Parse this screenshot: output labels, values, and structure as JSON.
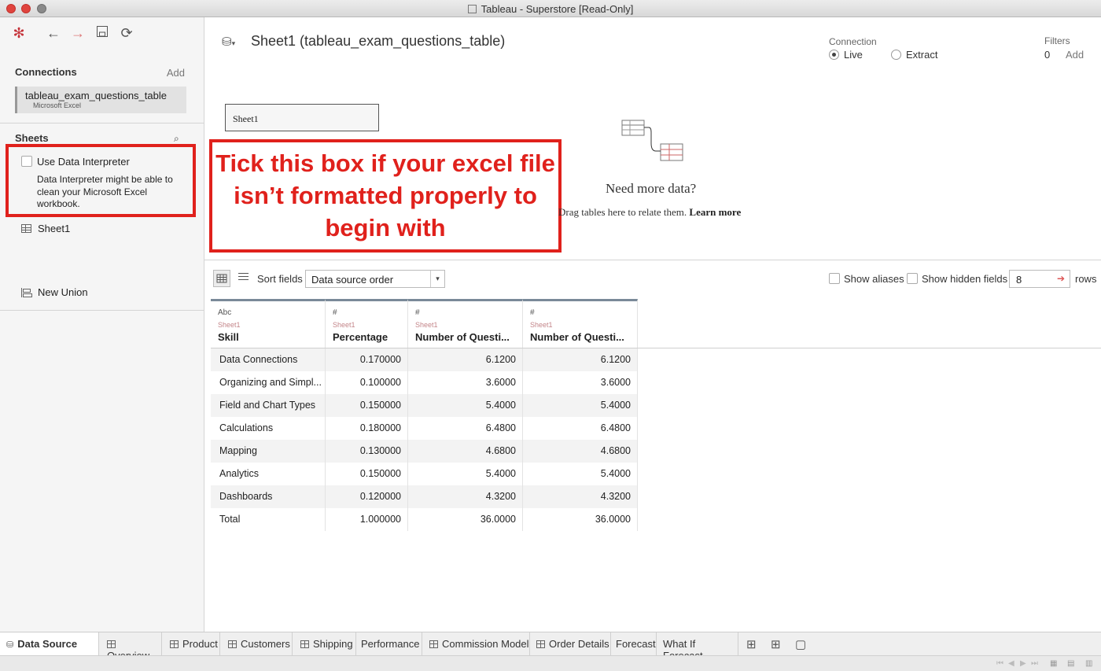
{
  "window": {
    "title": "Tableau - Superstore [Read-Only]"
  },
  "toolbar": {
    "icons": [
      "tableau-logo-icon",
      "back-icon",
      "forward-icon",
      "save-icon",
      "refresh-icon"
    ]
  },
  "sidebar": {
    "connections_title": "Connections",
    "add_label": "Add",
    "connection": {
      "name": "tableau_exam_questions_table",
      "type": "Microsoft Excel"
    },
    "sheets_title": "Sheets",
    "interpreter": {
      "label": "Use Data Interpreter",
      "checked": false,
      "description": "Data Interpreter might be able to clean your Microsoft Excel workbook."
    },
    "sheet_item": "Sheet1",
    "new_union": "New Union"
  },
  "header": {
    "title": "Sheet1 (tableau_exam_questions_table)",
    "connection_label": "Connection",
    "live_label": "Live",
    "extract_label": "Extract",
    "selected_connection": "Live",
    "filters_label": "Filters",
    "filters_count": "0",
    "filters_add": "Add"
  },
  "canvas": {
    "sheet_pill": "Sheet1",
    "callout": "Tick this box if your excel file isn’t formatted properly to begin with",
    "need_more": "Need more data?",
    "drag_text": "Drag tables here to relate them.",
    "learn_more": "Learn more"
  },
  "grid_toolbar": {
    "sort_label": "Sort fields",
    "sort_value": "Data source order",
    "show_aliases": "Show aliases",
    "show_hidden": "Show hidden fields",
    "rows_value": "8",
    "rows_label": "rows"
  },
  "grid": {
    "columns": [
      {
        "type": "Abc",
        "source": "Sheet1",
        "name": "Skill"
      },
      {
        "type": "#",
        "source": "Sheet1",
        "name": "Percentage"
      },
      {
        "type": "#",
        "source": "Sheet1",
        "name": "Number of Questi..."
      },
      {
        "type": "#",
        "source": "Sheet1",
        "name": "Number of Questi..."
      }
    ],
    "rows": [
      [
        "Data Connections",
        "0.170000",
        "6.1200",
        "6.1200"
      ],
      [
        "Organizing and Simpl...",
        "0.100000",
        "3.6000",
        "3.6000"
      ],
      [
        "Field and Chart Types",
        "0.150000",
        "5.4000",
        "5.4000"
      ],
      [
        "Calculations",
        "0.180000",
        "6.4800",
        "6.4800"
      ],
      [
        "Mapping",
        "0.130000",
        "4.6800",
        "4.6800"
      ],
      [
        "Analytics",
        "0.150000",
        "5.4000",
        "5.4000"
      ],
      [
        "Dashboards",
        "0.120000",
        "4.3200",
        "4.3200"
      ],
      [
        "Total",
        "1.000000",
        "36.0000",
        "36.0000"
      ]
    ]
  },
  "tabs": [
    "Data Source",
    "Overview",
    "Product",
    "Customers",
    "Shipping",
    "Performance",
    "Commission Model",
    "Order Details",
    "Forecast",
    "What If Forecast"
  ],
  "colors": {
    "annotation_red": "#e0211c",
    "header_bar": "#7a8a99",
    "source_pink": "#c4868a"
  }
}
